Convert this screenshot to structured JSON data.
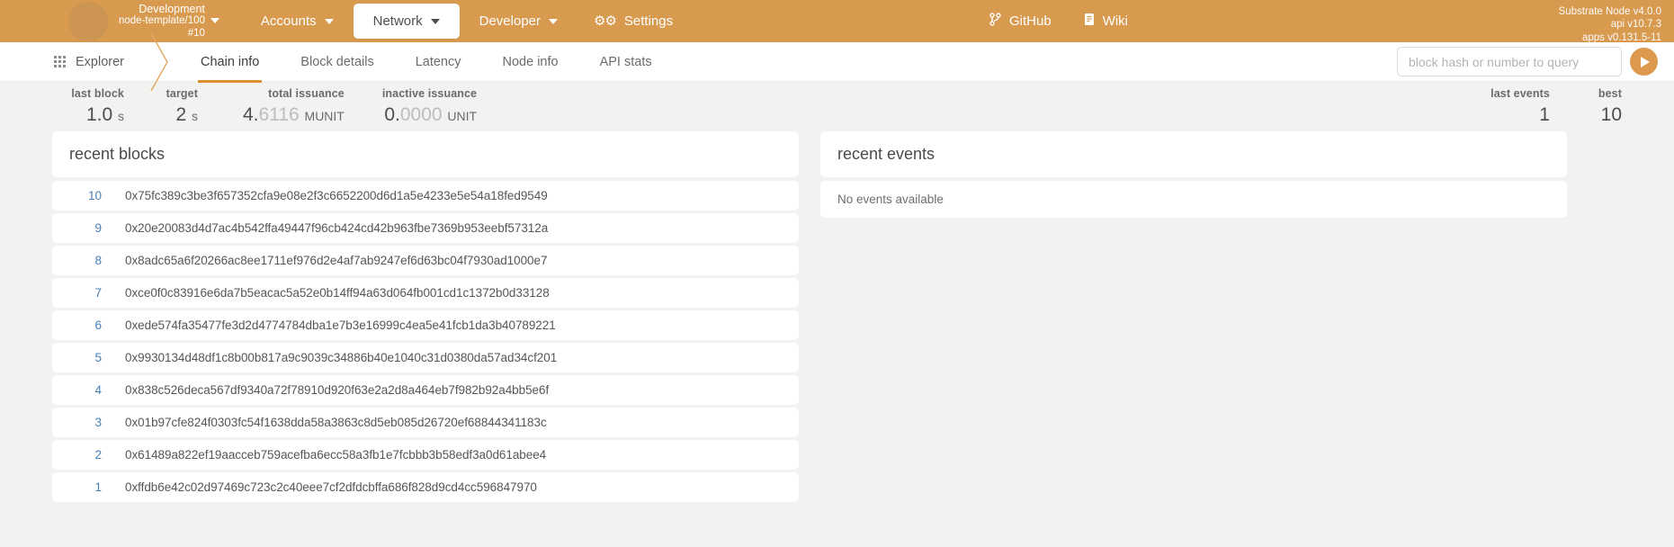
{
  "topbar": {
    "chain": {
      "name": "Development",
      "node": "node-template/100",
      "block": "#10"
    },
    "menu": [
      {
        "label": "Accounts",
        "icon": "chevron-down-icon",
        "active": false
      },
      {
        "label": "Network",
        "icon": "chevron-down-icon",
        "active": true
      },
      {
        "label": "Developer",
        "icon": "chevron-down-icon",
        "active": false
      },
      {
        "label": "Settings",
        "icon": "gear-icon",
        "active": false
      }
    ],
    "links": [
      {
        "label": "GitHub",
        "icon": "git-branch-icon"
      },
      {
        "label": "Wiki",
        "icon": "book-icon"
      }
    ],
    "version": {
      "node": "Substrate Node v4.0.0",
      "api": "api v10.7.3",
      "apps": "apps v0.131.5-11"
    }
  },
  "navbar": {
    "section": "Explorer",
    "tabs": [
      {
        "label": "Chain info",
        "active": true
      },
      {
        "label": "Block details",
        "active": false
      },
      {
        "label": "Latency",
        "active": false
      },
      {
        "label": "Node info",
        "active": false
      },
      {
        "label": "API stats",
        "active": false
      }
    ],
    "search": {
      "placeholder": "block hash or number to query",
      "value": ""
    }
  },
  "stats": {
    "left": [
      {
        "label": "last block",
        "value": "1.0",
        "dim": "",
        "unit": "s"
      },
      {
        "label": "target",
        "value": "2",
        "dim": "",
        "unit": "s"
      },
      {
        "label": "total issuance",
        "value": "4.",
        "dim": "6116",
        "unit": "MUNIT"
      },
      {
        "label": "inactive issuance",
        "value": "0.",
        "dim": "0000",
        "unit": "UNIT"
      }
    ],
    "right": [
      {
        "label": "last events",
        "value": "1"
      },
      {
        "label": "best",
        "value": "10"
      }
    ]
  },
  "recent_blocks": {
    "title": "recent blocks",
    "rows": [
      {
        "number": "10",
        "hash": "0x75fc389c3be3f657352cfa9e08e2f3c6652200d6d1a5e4233e5e54a18fed9549"
      },
      {
        "number": "9",
        "hash": "0x20e20083d4d7ac4b542ffa49447f96cb424cd42b963fbe7369b953eebf57312a"
      },
      {
        "number": "8",
        "hash": "0x8adc65a6f20266ac8ee1711ef976d2e4af7ab9247ef6d63bc04f7930ad1000e7"
      },
      {
        "number": "7",
        "hash": "0xce0f0c83916e6da7b5eacac5a52e0b14ff94a63d064fb001cd1c1372b0d33128"
      },
      {
        "number": "6",
        "hash": "0xede574fa35477fe3d2d4774784dba1e7b3e16999c4ea5e41fcb1da3b40789221"
      },
      {
        "number": "5",
        "hash": "0x9930134d48df1c8b00b817a9c9039c34886b40e1040c31d0380da57ad34cf201"
      },
      {
        "number": "4",
        "hash": "0x838c526deca567df9340a72f78910d920f63e2a2d8a464eb7f982b92a4bb5e6f"
      },
      {
        "number": "3",
        "hash": "0x01b97cfe824f0303fc54f1638dda58a3863c8d5eb085d26720ef68844341183c"
      },
      {
        "number": "2",
        "hash": "0x61489a822ef19aacceb759acefba6ecc58a3fb1e7fcbbb3b58edf3a0d61abee4"
      },
      {
        "number": "1",
        "hash": "0xffdb6e42c02d97469c723c2c40eee7cf2dfdcbffa686f828d9cd4cc596847970"
      }
    ]
  },
  "recent_events": {
    "title": "recent events",
    "empty_text": "No events available"
  }
}
